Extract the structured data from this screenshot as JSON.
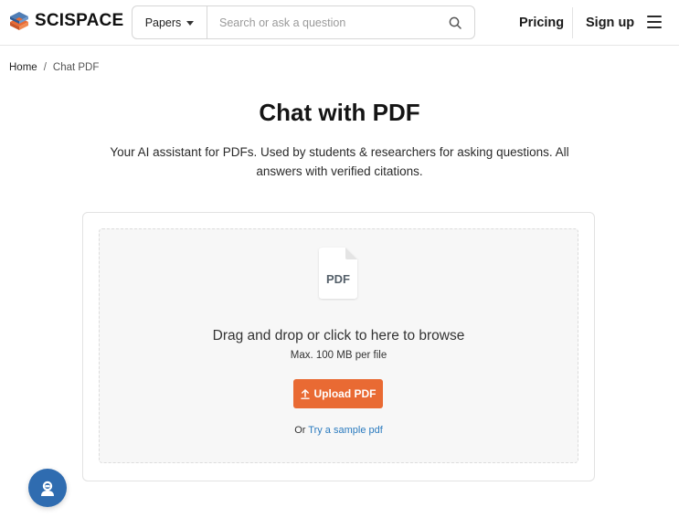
{
  "brand": {
    "name": "SCISPACE",
    "colors": {
      "logo_primary": "#1d3f6e",
      "logo_accent": "#e96a33"
    }
  },
  "header": {
    "papers_select": {
      "selected": "Papers"
    },
    "search": {
      "placeholder": "Search or ask a question",
      "value": ""
    },
    "pricing_label": "Pricing",
    "signup_label": "Sign up"
  },
  "breadcrumb": {
    "home": "Home",
    "separator": "/",
    "current": "Chat PDF"
  },
  "main": {
    "title": "Chat with PDF",
    "subtitle": "Your AI assistant for PDFs. Used by students & researchers for asking questions. All answers with verified citations."
  },
  "upload": {
    "file_icon_label": "PDF",
    "drop_text": "Drag and drop or click to here to browse",
    "max_text": "Max. 100 MB per file",
    "button_label": "Upload PDF",
    "sample_prefix": "Or",
    "sample_link": "Try a sample pdf",
    "colors": {
      "button": "#e96a33",
      "link": "#2b7bbf"
    }
  },
  "icons": {
    "search": "search-icon",
    "menu": "hamburger-menu-icon",
    "upload": "upload-arrow-icon",
    "chat": "chat-support-icon"
  }
}
